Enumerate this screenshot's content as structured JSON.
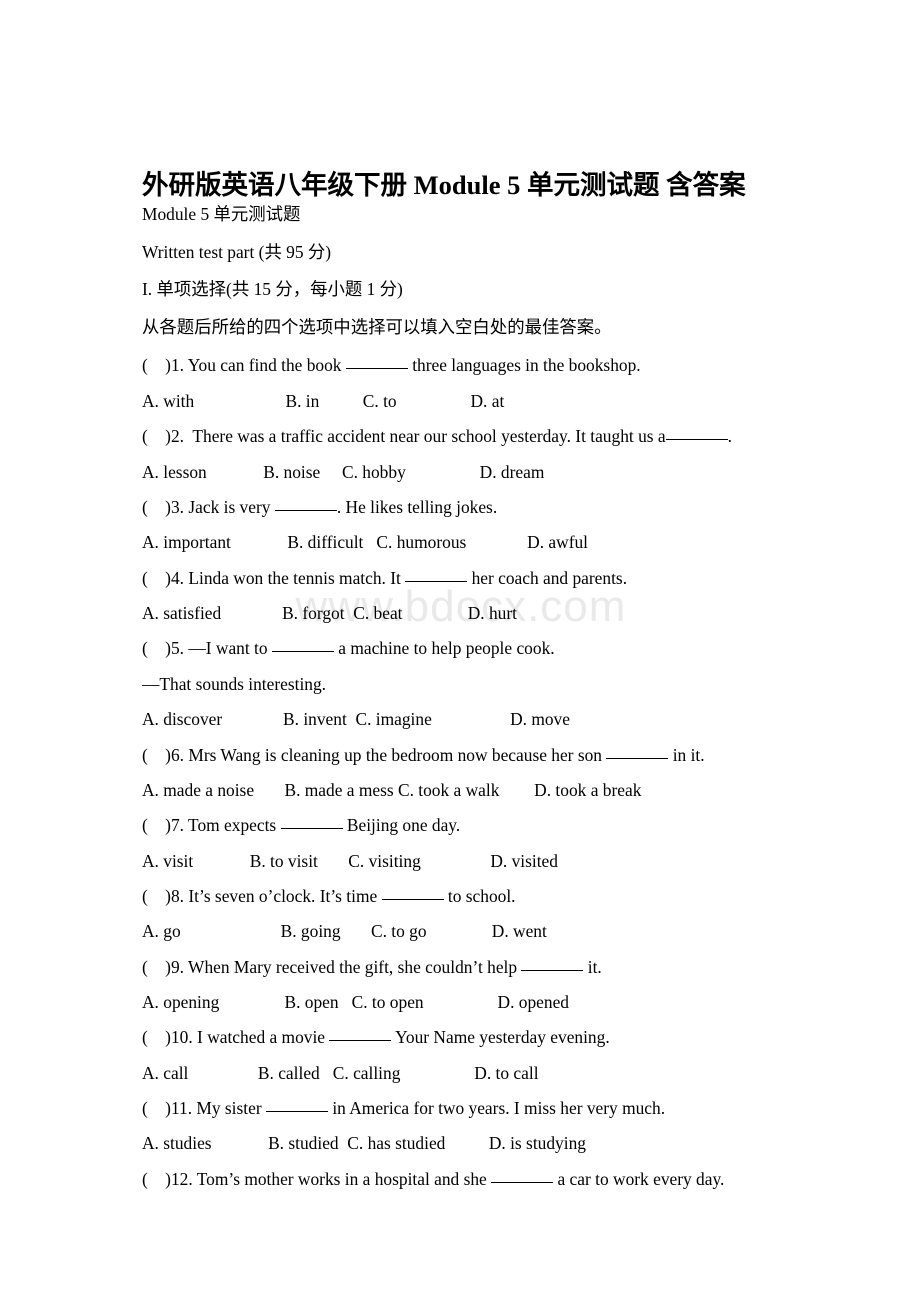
{
  "document": {
    "title": "外研版英语八年级下册 Module 5 单元测试题 含答案",
    "watermark": "www.bdocx.com",
    "header_lines": [
      "Module 5 单元测试题",
      "Written test part (共 95 分)",
      "I. 单项选择(共 15 分，每小题 1 分)",
      "从各题后所给的四个选项中选择可以填入空白处的最佳答案。"
    ],
    "questions": [
      {
        "stem_pre": "(    )1. You can find the book ",
        "stem_post": " three languages in the bookshop.",
        "options_line": "A. with                     B. in          C. to                 D. at"
      },
      {
        "stem_pre": "(    )2.  There was a traffic accident near our school yesterday. It taught us a",
        "stem_post": ".",
        "options_line": "A. lesson             B. noise     C. hobby                 D. dream"
      },
      {
        "stem_pre": "(    )3. Jack is very ",
        "stem_post": ". He likes telling jokes.",
        "options_line": "A. important             B. difficult   C. humorous              D. awful"
      },
      {
        "stem_pre": "(    )4. Linda won the tennis match. It ",
        "stem_post": " her coach and parents.",
        "options_line": "A. satisfied              B. forgot  C. beat               D. hurt"
      },
      {
        "stem_pre": "(    )5. —I want to ",
        "stem_post": " a machine to help people cook.",
        "extra_line": "—That sounds interesting.",
        "options_line": "A. discover              B. invent  C. imagine                  D. move"
      },
      {
        "stem_pre": "(    )6. Mrs Wang is cleaning up the bedroom now because her son ",
        "stem_post": " in it.",
        "options_line": "A. made a noise       B. made a mess C. took a walk        D. took a break"
      },
      {
        "stem_pre": "(    )7. Tom expects ",
        "stem_post": " Beijing one day.",
        "options_line": "A. visit             B. to visit       C. visiting                D. visited"
      },
      {
        "stem_pre": "(    )8. It’s seven o’clock. It’s time ",
        "stem_post": " to school.",
        "options_line": "A. go                       B. going       C. to go               D. went"
      },
      {
        "stem_pre": "(    )9. When Mary received the gift, she couldn’t help ",
        "stem_post": " it.",
        "options_line": "A. opening               B. open   C. to open                 D. opened"
      },
      {
        "stem_pre": "(    )10. I watched a movie ",
        "stem_post": " Your Name yesterday evening.",
        "options_line": "A. call                B. called   C. calling                 D. to call"
      },
      {
        "stem_pre": "(    )11. My sister ",
        "stem_post": " in America for two years. I miss her very much.",
        "options_line": "A. studies             B. studied  C. has studied          D. is studying"
      },
      {
        "stem_pre": "(    )12. Tom’s mother works in a hospital and she ",
        "stem_post": " a car to work every day.",
        "options_line": ""
      }
    ]
  }
}
